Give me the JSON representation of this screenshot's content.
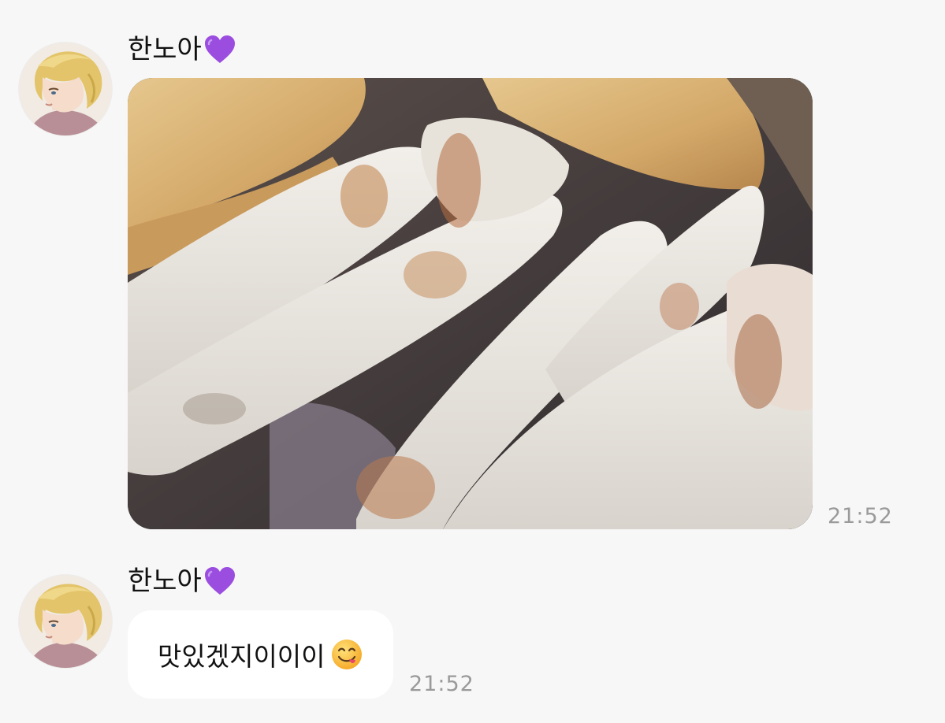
{
  "messages": [
    {
      "sender": "한노아",
      "sender_badge_icon": "purple-heart-icon",
      "type": "image",
      "image_description_icon": "fried-dumplings-photo",
      "time": "21:52"
    },
    {
      "sender": "한노아",
      "sender_badge_icon": "purple-heart-icon",
      "type": "text",
      "text": "맛있겠지이이이",
      "emoji_icon": "face-savoring-food-icon",
      "time": "21:52"
    }
  ],
  "colors": {
    "background": "#f7f7f7",
    "bubble": "#ffffff",
    "heart": "#9b4de0",
    "time_text": "#9a9a9a"
  }
}
